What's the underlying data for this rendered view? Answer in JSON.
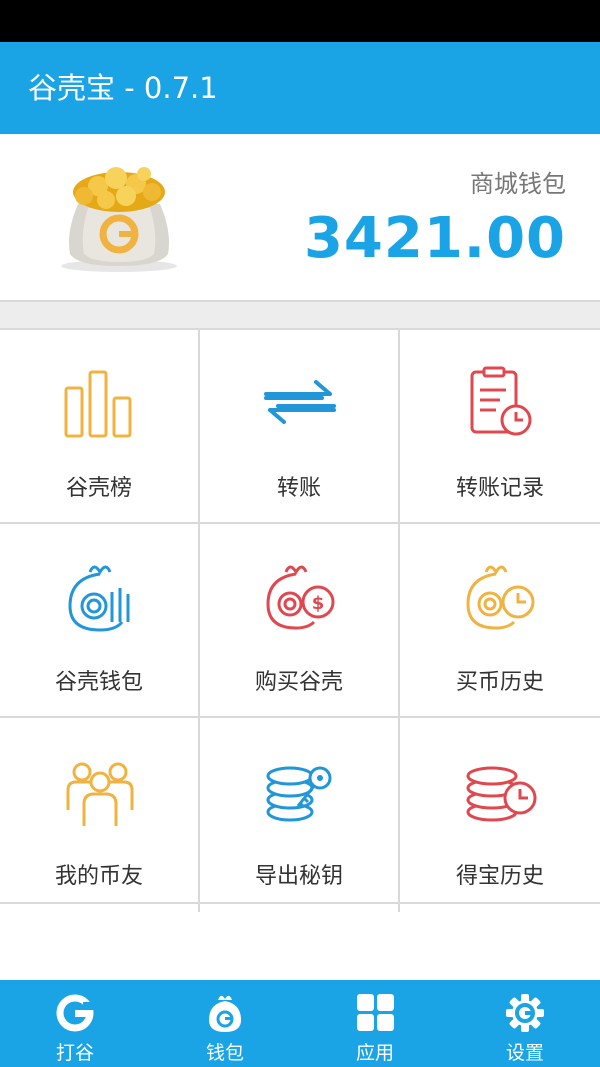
{
  "app": {
    "title": "谷壳宝 - 0.7.1"
  },
  "wallet": {
    "label": "商城钱包",
    "amount": "3421.00",
    "icon": "money-bag-icon"
  },
  "colors": {
    "primary": "#1aa3e5",
    "orange": "#f0b341",
    "red": "#e0484f",
    "blue": "#2196d8"
  },
  "grid": {
    "items": [
      {
        "label": "谷壳榜",
        "icon": "bar-chart-icon"
      },
      {
        "label": "转账",
        "icon": "transfer-arrows-icon"
      },
      {
        "label": "转账记录",
        "icon": "transfer-record-icon"
      },
      {
        "label": "谷壳钱包",
        "icon": "shell-wallet-icon"
      },
      {
        "label": "购买谷壳",
        "icon": "buy-shell-icon"
      },
      {
        "label": "买币历史",
        "icon": "buy-history-icon"
      },
      {
        "label": "我的币友",
        "icon": "friends-icon"
      },
      {
        "label": "导出秘钥",
        "icon": "export-key-icon"
      },
      {
        "label": "得宝历史",
        "icon": "treasure-history-icon"
      }
    ]
  },
  "nav": {
    "items": [
      {
        "label": "打谷",
        "icon": "g-logo-icon"
      },
      {
        "label": "钱包",
        "icon": "wallet-bag-icon"
      },
      {
        "label": "应用",
        "icon": "apps-grid-icon"
      },
      {
        "label": "设置",
        "icon": "settings-gear-icon"
      }
    ]
  }
}
